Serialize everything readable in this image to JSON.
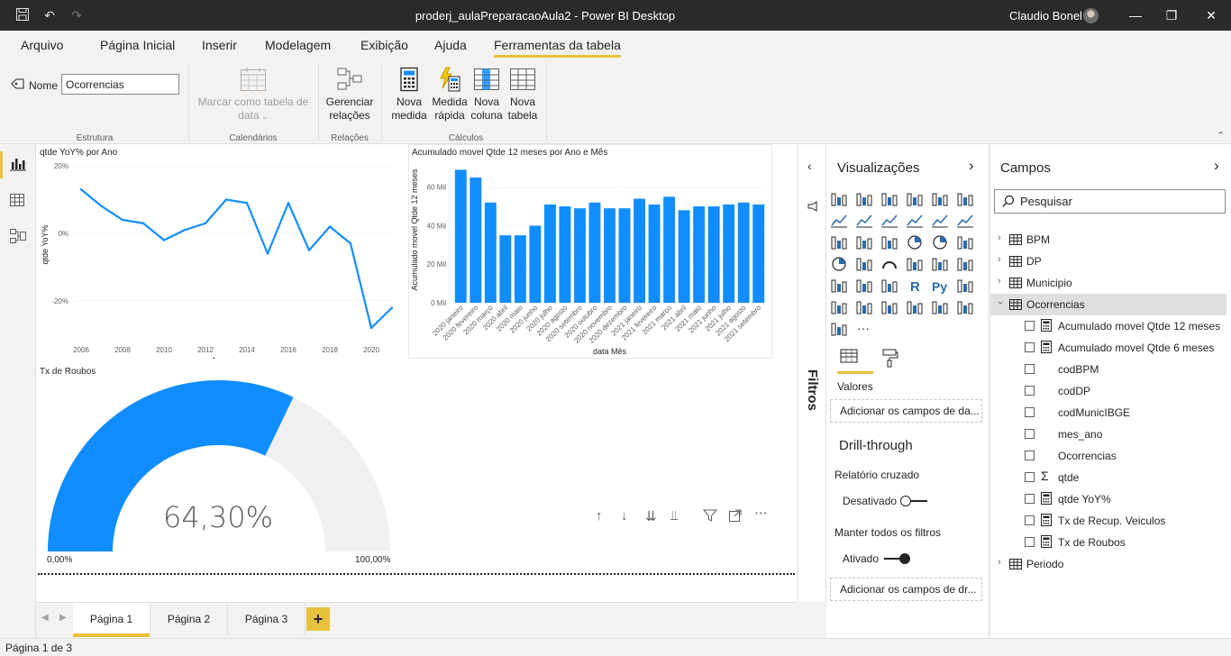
{
  "titlebar": {
    "app_title": "proderj_aulaPreparacaoAula2 - Power BI Desktop",
    "user": "Claudio Bonel"
  },
  "ribbon_tabs": [
    "Arquivo",
    "Página Inicial",
    "Inserir",
    "Modelagem",
    "Exibição",
    "Ajuda",
    "Ferramentas da tabela"
  ],
  "ribbon": {
    "name_label": "Nome",
    "name_value": "Ocorrencias",
    "mark_date_table": [
      "Marcar como tabela de",
      "data"
    ],
    "manage_relations": [
      "Gerenciar",
      "relações"
    ],
    "new_measure": [
      "Nova",
      "medida"
    ],
    "quick_measure": [
      "Medida",
      "rápida"
    ],
    "new_column": [
      "Nova",
      "coluna"
    ],
    "new_table": [
      "Nova",
      "tabela"
    ],
    "groups": [
      "Estrutura",
      "Calendários",
      "Relações",
      "Cálculos"
    ]
  },
  "visuals": {
    "line_title": "qtde YoY% por Ano",
    "bar_title": "Acumulado movel Qtde 12 meses por Ano e Mês",
    "gauge_title": "Tx de Roubos",
    "gauge_value": "64,30%",
    "gauge_min": "0,00%",
    "gauge_max": "100,00%"
  },
  "chart_data": [
    {
      "type": "line",
      "title": "qtde YoY% por Ano",
      "xlabel": "Ano",
      "ylabel": "qtde YoY%",
      "x": [
        2006,
        2007,
        2008,
        2009,
        2010,
        2011,
        2012,
        2013,
        2014,
        2015,
        2016,
        2017,
        2018,
        2019,
        2020,
        2021
      ],
      "y": [
        13,
        8,
        4,
        3,
        -2,
        1,
        3,
        10,
        9,
        -6,
        9,
        -5,
        2,
        -3,
        -28,
        -22
      ],
      "x_ticks": [
        "2006",
        "2008",
        "2010",
        "2012",
        "2014",
        "2016",
        "2018",
        "2020"
      ],
      "y_ticks": [
        "20%",
        "0%",
        "-20%"
      ],
      "ylim": [
        -32,
        20
      ],
      "color": "#118dff"
    },
    {
      "type": "bar",
      "title": "Acumulado movel Qtde 12 meses por Ano e Mês",
      "xlabel": "data Mês",
      "ylabel": "Acumulado movel Qtde 12 meses",
      "categories": [
        "2020 janeiro",
        "2020 fevereiro",
        "2020 março",
        "2020 abril",
        "2020 maio",
        "2020 junho",
        "2020 julho",
        "2020 agosto",
        "2020 setembro",
        "2020 outubro",
        "2020 novembro",
        "2020 dezembro",
        "2021 janeiro",
        "2021 fevereiro",
        "2021 março",
        "2021 abril",
        "2021 maio",
        "2021 junho",
        "2021 julho",
        "2021 agosto",
        "2021 setembro"
      ],
      "values": [
        69,
        65,
        52,
        35,
        35,
        40,
        51,
        50,
        49,
        52,
        49,
        49,
        54,
        51,
        55,
        48,
        50,
        50,
        51,
        52,
        51
      ],
      "y_ticks": [
        "0 Mil",
        "20 Mil",
        "40 Mil",
        "60 Mil"
      ],
      "ylim": [
        0,
        72
      ],
      "color": "#118dff"
    },
    {
      "type": "gauge",
      "title": "Tx de Roubos",
      "value": 64.3,
      "min": 0,
      "max": 100,
      "value_color": "#118dff",
      "track_color": "#f0f0f0"
    }
  ],
  "pages": [
    "Página 1",
    "Página 2",
    "Página 3"
  ],
  "add_page": "+",
  "status": "Página 1 de 3",
  "filters_label": "Filtros",
  "viz_pane": {
    "title": "Visualizações",
    "values_label": "Valores",
    "values_well": "Adicionar os campos de da...",
    "drillthrough_title": "Drill-through",
    "cross_report": "Relatório cruzado",
    "cross_report_state": "Desativado",
    "keep_filters": "Manter todos os filtros",
    "keep_filters_state": "Ativado",
    "drill_well": "Adicionar os campos de dr..."
  },
  "fields_pane": {
    "title": "Campos",
    "search_placeholder": "Pesquisar",
    "tables": [
      "BPM",
      "DP",
      "Municipio",
      "Ocorrencias",
      "Periodo"
    ],
    "ocorrencias_fields": [
      {
        "label": "Acumulado movel Qtde 12 meses",
        "icon": "calculator-icon"
      },
      {
        "label": "Acumulado movel Qtde 6 meses",
        "icon": "calculator-icon"
      },
      {
        "label": "codBPM",
        "icon": ""
      },
      {
        "label": "codDP",
        "icon": ""
      },
      {
        "label": "codMunicIBGE",
        "icon": ""
      },
      {
        "label": "mes_ano",
        "icon": ""
      },
      {
        "label": "Ocorrencias",
        "icon": ""
      },
      {
        "label": "qtde",
        "icon": "sigma-icon"
      },
      {
        "label": "qtde YoY%",
        "icon": "calculator-icon"
      },
      {
        "label": "Tx de Recup. Veiculos",
        "icon": "calculator-icon"
      },
      {
        "label": "Tx de Roubos",
        "icon": "calculator-icon"
      }
    ]
  }
}
